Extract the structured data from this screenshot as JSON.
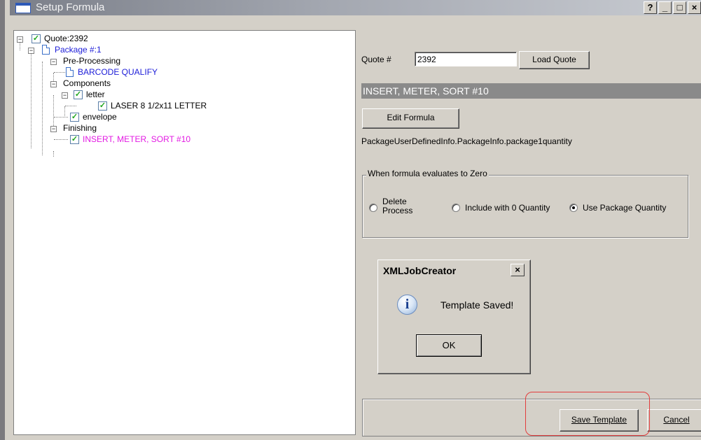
{
  "window": {
    "title": "Setup Formula",
    "buttons": [
      "?",
      "_",
      "□",
      "×"
    ]
  },
  "tree": {
    "root": "Quote:2392",
    "package": "Package #:1",
    "preprocessing": "Pre-Processing",
    "barcode": "BARCODE QUALIFY",
    "components": "Components",
    "letter": "letter",
    "laser": "LASER 8 1/2x11 LETTER",
    "envelope": "envelope",
    "finishing": "Finishing",
    "insert": "INSERT, METER, SORT #10"
  },
  "form": {
    "quote_label": "Quote #",
    "quote_value": "2392",
    "load_quote": "Load Quote",
    "section_title": "INSERT, METER, SORT #10",
    "edit_formula": "Edit Formula",
    "formula_text": "PackageUserDefinedInfo.PackageInfo.package1quantity",
    "group_title": "When formula evaluates to Zero",
    "radio_delete": "Delete\nProcess",
    "radio_delete_1": "Delete",
    "radio_delete_2": "Process",
    "radio_include": "Include with 0 Quantity",
    "radio_use": "Use Package Quantity",
    "selected_option": "Use Package Quantity"
  },
  "dialog": {
    "title": "XMLJobCreator",
    "close": "×",
    "message": "Template Saved!",
    "ok": "OK"
  },
  "footer": {
    "save_template": "Save Template",
    "cancel": "Cancel"
  },
  "colors": {
    "tree_blue": "#1d1dd8",
    "tree_magenta": "#e31ae3",
    "highlight": "#e23d3d"
  }
}
